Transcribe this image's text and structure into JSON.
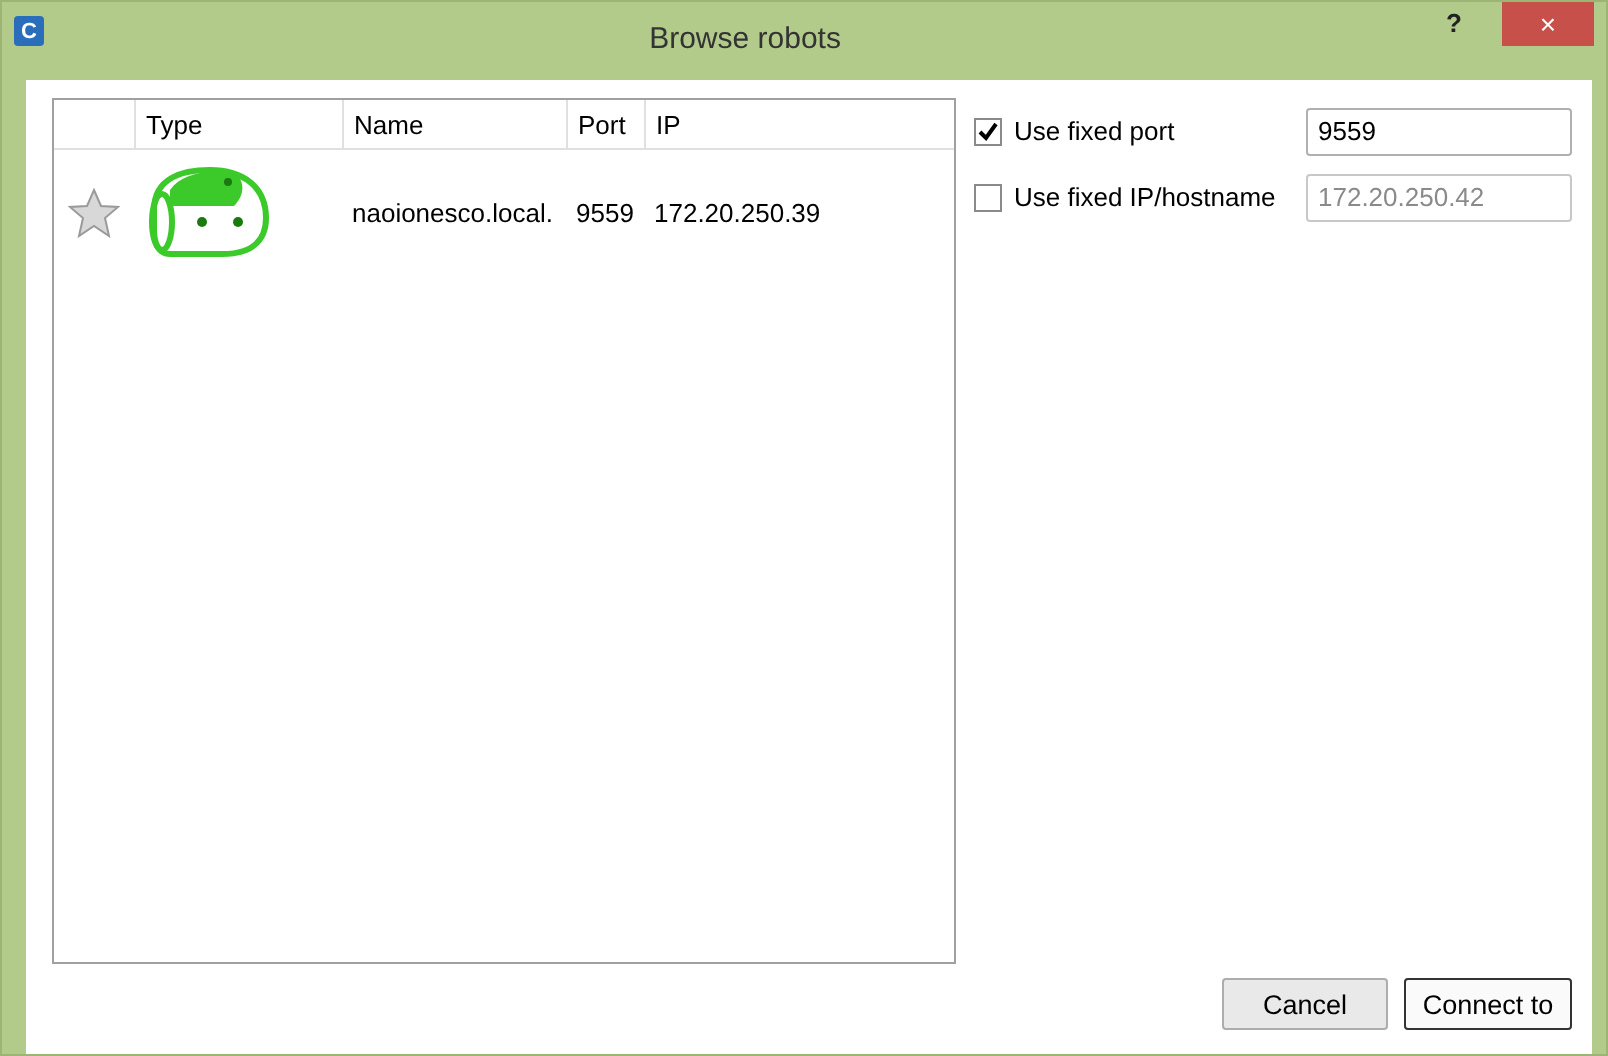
{
  "window": {
    "title": "Browse robots",
    "app_icon": "C",
    "help": "?",
    "close": "×"
  },
  "table": {
    "columns": [
      "Type",
      "Name",
      "Port",
      "IP"
    ],
    "rows": [
      {
        "favorite": false,
        "selected": false,
        "name": "naoionesco.local.",
        "port": "9559",
        "ip": "172.20.250.39"
      }
    ]
  },
  "options": [
    {
      "label": "Use fixed port",
      "checked": true,
      "value": "9559",
      "disabled": false
    },
    {
      "label": "Use fixed IP/hostname",
      "checked": false,
      "value": "172.20.250.42",
      "disabled": true
    }
  ],
  "buttons": [
    {
      "label": "Cancel",
      "default": false
    },
    {
      "label": "Connect to",
      "default": true
    }
  ]
}
